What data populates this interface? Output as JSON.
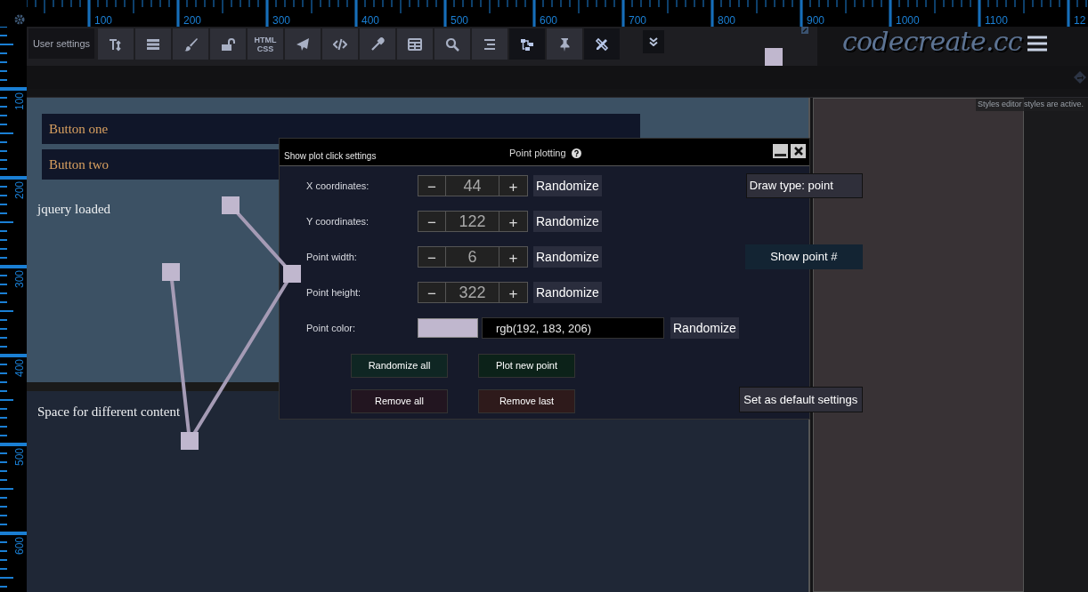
{
  "top_ruler": {
    "labels": [
      "100",
      "200",
      "300",
      "400",
      "500",
      "600",
      "700",
      "800",
      "900",
      "1000",
      "1100",
      "12"
    ]
  },
  "left_ruler": {
    "labels": [
      "100",
      "200",
      "300",
      "400",
      "500",
      "600"
    ]
  },
  "toolbar": {
    "label": "User settings",
    "items": [
      {
        "kind": "icon",
        "active": false
      },
      {
        "kind": "icon",
        "active": false
      },
      {
        "kind": "icon",
        "active": false
      },
      {
        "kind": "icon",
        "active": false
      },
      {
        "kind": "text",
        "label": "HTML CSS",
        "active": false
      },
      {
        "kind": "icon",
        "active": false
      },
      {
        "kind": "icon",
        "active": false
      },
      {
        "kind": "icon",
        "active": false
      },
      {
        "kind": "icon",
        "active": false
      },
      {
        "kind": "icon",
        "active": false
      },
      {
        "kind": "icon",
        "active": false
      },
      {
        "kind": "icon",
        "active": true
      },
      {
        "kind": "icon",
        "active": false
      },
      {
        "kind": "icon",
        "active": true
      }
    ]
  },
  "logo": "codecreate.cc",
  "notice": "Styles editor styles are active.",
  "content": {
    "buttons": [
      "Button one",
      "Button two"
    ],
    "status": "jquery loaded",
    "lower_text": "Space for different content"
  },
  "dialog": {
    "left_link": "Show plot click settings",
    "title": "Point plotting",
    "rows": [
      {
        "label": "X coordinates:",
        "value": "44",
        "minus": "−",
        "plus": "+",
        "button": "Randomize"
      },
      {
        "label": "Y coordinates:",
        "value": "122",
        "minus": "−",
        "plus": "+",
        "button": "Randomize"
      },
      {
        "label": "Point width:",
        "value": "6",
        "minus": "−",
        "plus": "+",
        "button": "Randomize"
      },
      {
        "label": "Point height:",
        "value": "322",
        "minus": "−",
        "plus": "+",
        "button": "Randomize"
      }
    ],
    "color_row": {
      "label": "Point color:",
      "value": "rgb(192, 183, 206)",
      "button": "Randomize"
    },
    "side_buttons": [
      "Draw type: point",
      "Show point #"
    ],
    "actions": [
      {
        "label": "Randomize all",
        "kind": "go"
      },
      {
        "label": "Plot new point",
        "kind": "add"
      },
      {
        "label": "Remove all",
        "kind": "remove"
      },
      {
        "label": "Remove last",
        "kind": "undo"
      }
    ],
    "default_button": "Set as default settings"
  }
}
